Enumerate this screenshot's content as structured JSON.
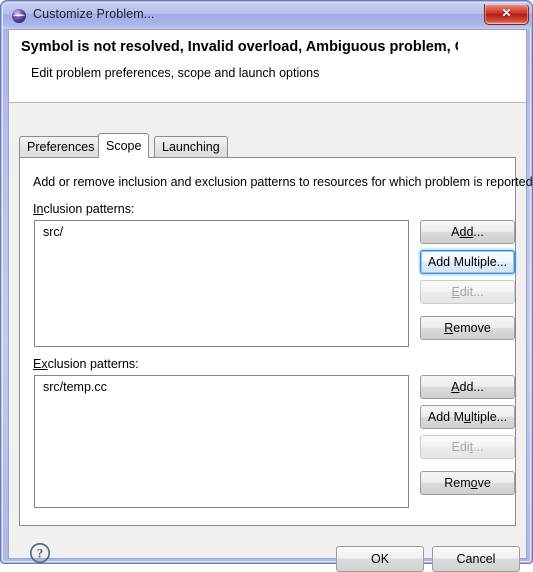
{
  "window": {
    "title": "Customize Problem...",
    "icon": "eclipse-sphere-icon",
    "close_glyph": "✕"
  },
  "header": {
    "title": "Symbol is not resolved, Invalid overload, Ambiguous problem, Circular",
    "subtitle": "Edit problem preferences, scope and launch options"
  },
  "tabs": [
    {
      "label": "Preferences",
      "active": false
    },
    {
      "label": "Scope",
      "active": true
    },
    {
      "label": "Launching",
      "active": false
    }
  ],
  "scope": {
    "description": "Add or remove inclusion and exclusion patterns to resources for which problem is reported",
    "inclusion": {
      "label_pre": "I",
      "label_mnemonic": "n",
      "label_post": "clusion patterns:",
      "label_full": "Inclusion patterns:",
      "items": [
        "src/"
      ],
      "buttons": [
        {
          "label": "Add...",
          "mnemonic": "dd",
          "pre": "A",
          "post": "...",
          "state": "normal"
        },
        {
          "label": "Add Multiple...",
          "mnemonic": "",
          "pre": "Add Multiple...",
          "post": "",
          "state": "focused"
        },
        {
          "label": "Edit...",
          "mnemonic": "E",
          "pre": "",
          "post": "dit...",
          "state": "disabled"
        },
        {
          "label": "Remove",
          "mnemonic": "R",
          "pre": "",
          "post": "emove",
          "state": "normal"
        }
      ]
    },
    "exclusion": {
      "label_pre": "E",
      "label_mnemonic": "x",
      "label_post": "clusion patterns:",
      "label_full": "Exclusion patterns:",
      "items": [
        "src/temp.cc"
      ],
      "buttons": [
        {
          "label": "Add...",
          "mnemonic": "A",
          "pre": "",
          "post": "dd...",
          "state": "normal"
        },
        {
          "label": "Add Multiple...",
          "mnemonic": "u",
          "pre": "Add M",
          "post": "ltiple...",
          "state": "normal"
        },
        {
          "label": "Edit...",
          "mnemonic": "t",
          "pre": "Edi",
          "post": "...",
          "state": "disabled"
        },
        {
          "label": "Remove",
          "mnemonic": "o",
          "pre": "Rem",
          "post": "ve",
          "state": "normal"
        }
      ]
    }
  },
  "footer": {
    "help_icon": "question-mark-icon",
    "ok_label": "OK",
    "cancel_label": "Cancel"
  },
  "colors": {
    "titlebar": "#aab4e6",
    "close_red": "#c6281b",
    "focus_blue": "#3c8dde",
    "panel_bg": "#f0f0f0",
    "field_bg": "#ffffff"
  }
}
